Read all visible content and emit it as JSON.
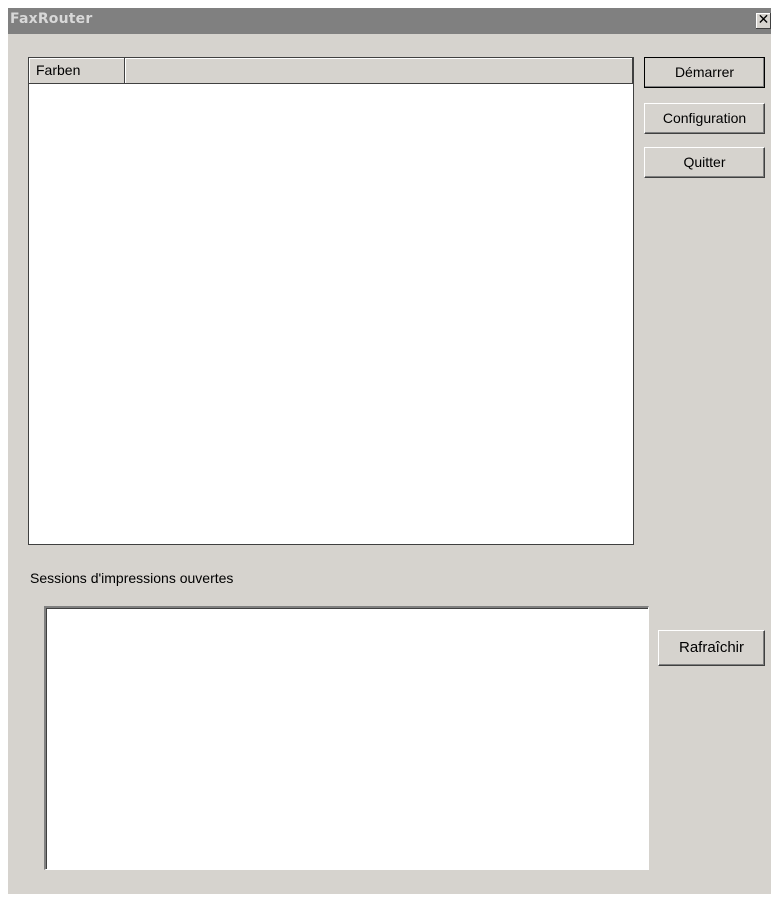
{
  "window": {
    "title": "FaxRouter",
    "close_glyph": "✕"
  },
  "listview": {
    "columns": [
      "Farben",
      ""
    ]
  },
  "buttons": {
    "start": "Démarrer",
    "configuration": "Configuration",
    "quit": "Quitter",
    "refresh": "Rafraîchir"
  },
  "sessions": {
    "label": "Sessions d'impressions ouvertes"
  },
  "colors": {
    "dialog_bg": "#d6d3ce",
    "titlebar_inactive": "#808080"
  }
}
